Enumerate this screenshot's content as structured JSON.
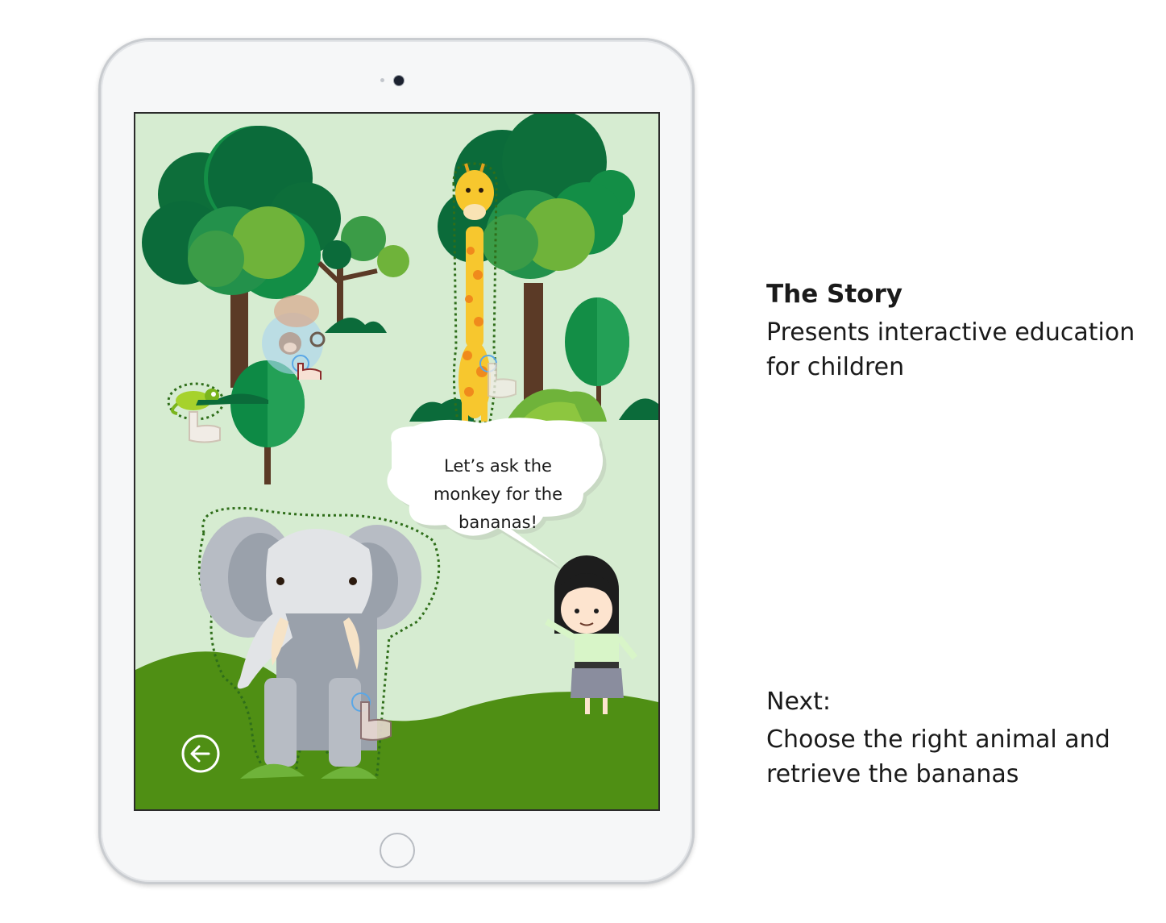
{
  "story": {
    "heading": "The Story",
    "description": "Presents interactive education for children"
  },
  "next": {
    "label": "Next:",
    "description": "Choose the right animal and retrieve the bananas"
  },
  "scene": {
    "speech_bubble": "Let’s ask the monkey for the bananas!",
    "back_icon": "arrow-left-circle-icon",
    "tappable_animals": [
      "elephant",
      "giraffe",
      "monkey",
      "chameleon"
    ]
  },
  "colors": {
    "sky": "#d6ecd1",
    "grass": "#4f8f14",
    "tree_dark": "#0b6b3a",
    "tree_light": "#6fb33a",
    "giraffe": "#f7c72e",
    "elephant": "#b7bcc4",
    "hotspot_outline": "#2f6e1a"
  }
}
